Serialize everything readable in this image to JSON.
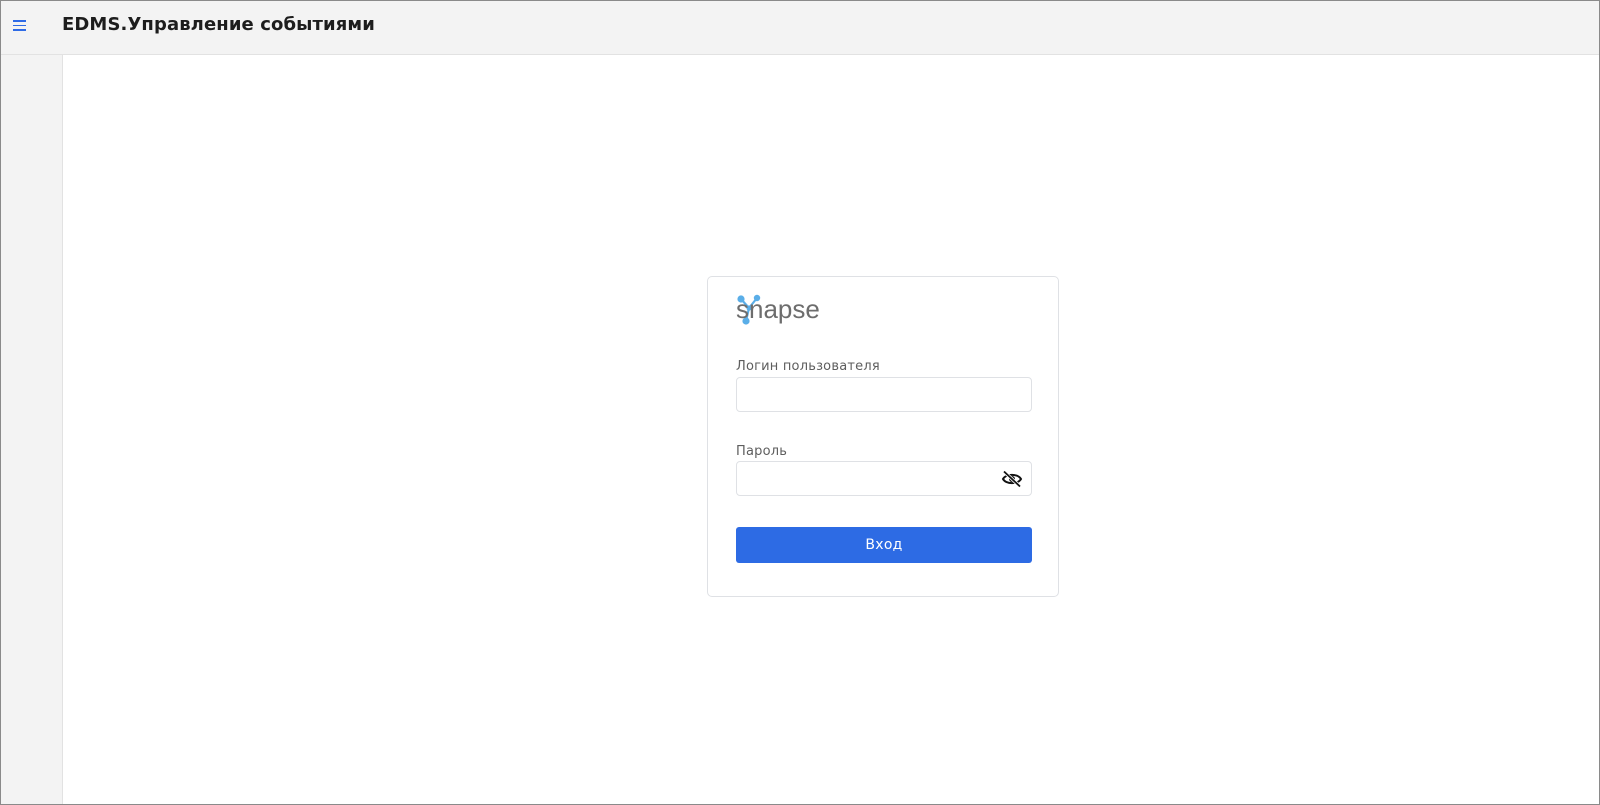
{
  "app": {
    "title": "EDMS.Управление событиями",
    "accent_color": "#2d6be4"
  },
  "header": {
    "menu_icon": "hamburger-menu-icon"
  },
  "login": {
    "logo_text": "snapse",
    "logo_icon": "synapse-molecule-icon",
    "logo_icon_color": "#5aaee8",
    "username_label": "Логин пользователя",
    "username_value": "",
    "password_label": "Пароль",
    "password_value": "",
    "password_toggle_icon": "eye-slash-icon",
    "submit_label": "Вход"
  }
}
